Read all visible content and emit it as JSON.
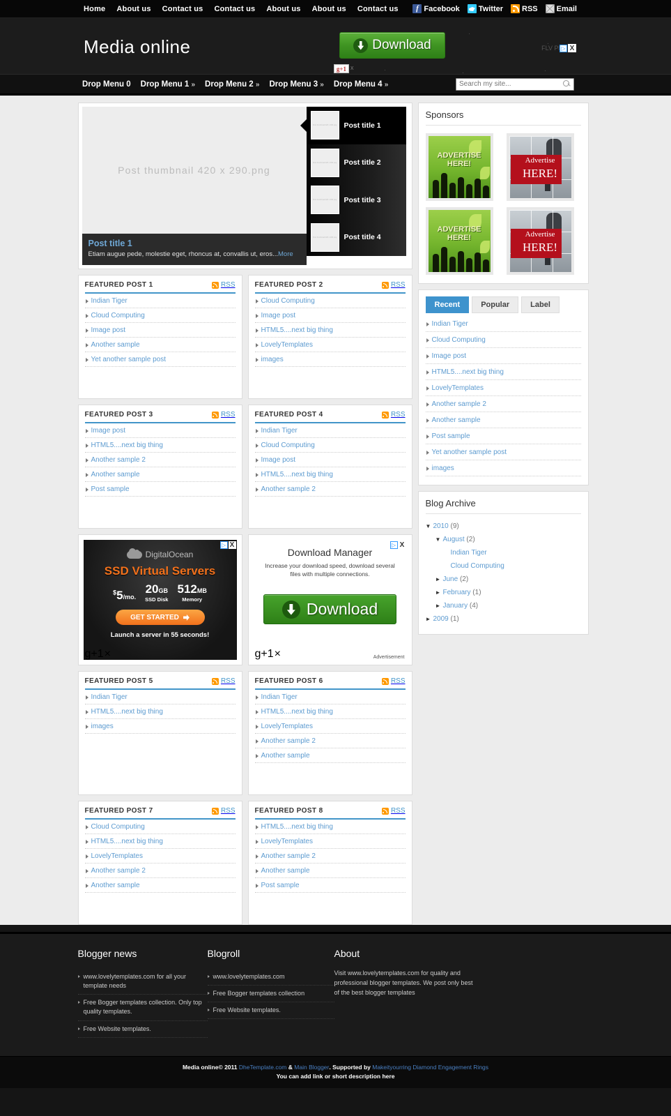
{
  "topbar": {
    "nav": [
      "Home",
      "About us",
      "Contact us",
      "Contact us",
      "About us",
      "About us",
      "Contact us"
    ],
    "social": [
      {
        "label": "Facebook",
        "icon": "facebook-icon"
      },
      {
        "label": "Twitter",
        "icon": "twitter-icon"
      },
      {
        "label": "RSS",
        "icon": "rss-icon"
      },
      {
        "label": "Email",
        "icon": "email-icon"
      }
    ]
  },
  "header": {
    "logo": "Media online",
    "ad": {
      "label": "Download",
      "gplus": "g+1",
      "close": "x",
      "flv_label": "FLV Play",
      "adchoices": "▷",
      "adclose": "X"
    }
  },
  "nav": {
    "menu": [
      {
        "label": "Drop Menu 0",
        "caret": ""
      },
      {
        "label": "Drop Menu 1",
        "caret": "»"
      },
      {
        "label": "Drop Menu 2",
        "caret": "»"
      },
      {
        "label": "Drop Menu 3",
        "caret": "»"
      },
      {
        "label": "Drop Menu 4",
        "caret": "»"
      }
    ],
    "search_placeholder": "Search my site...",
    "search_value": ""
  },
  "slider": {
    "main_image_label": "Post thumbnail 420 x 290.png",
    "caption_title": "Post title 1",
    "caption_text": "Etiam augue pede, molestie eget, rhoncus at, convallis ut, eros...",
    "caption_more": "More",
    "thumb_label": "Post thumbnail 420 x 290.png",
    "items": [
      {
        "title": "Post title 1",
        "active": true
      },
      {
        "title": "Post title 2",
        "active": false
      },
      {
        "title": "Post title 3",
        "active": false
      },
      {
        "title": "Post title 4",
        "active": false
      }
    ]
  },
  "featured": {
    "rss_label": "RSS",
    "boxes": [
      {
        "title": "FEATURED POST 1",
        "items": [
          "Indian Tiger",
          "Cloud Computing",
          "Image post",
          "Another sample",
          "Yet another sample post"
        ]
      },
      {
        "title": "FEATURED POST 2",
        "items": [
          "Cloud Computing",
          "Image post",
          "HTML5....next big thing",
          "LovelyTemplates",
          "images"
        ]
      },
      {
        "title": "FEATURED POST 3",
        "items": [
          "Image post",
          "HTML5....next big thing",
          "Another sample 2",
          "Another sample",
          "Post sample"
        ]
      },
      {
        "title": "FEATURED POST 4",
        "items": [
          "Indian Tiger",
          "Cloud Computing",
          "Image post",
          "HTML5....next big thing",
          "Another sample 2"
        ]
      },
      {
        "title": "FEATURED POST 5",
        "items": [
          "Indian Tiger",
          "HTML5....next big thing",
          "images"
        ]
      },
      {
        "title": "FEATURED POST 6",
        "items": [
          "Indian Tiger",
          "HTML5....next big thing",
          "LovelyTemplates",
          "Another sample 2",
          "Another sample"
        ]
      },
      {
        "title": "FEATURED POST 7",
        "items": [
          "Cloud Computing",
          "HTML5....next big thing",
          "LovelyTemplates",
          "Another sample 2",
          "Another sample"
        ]
      },
      {
        "title": "FEATURED POST 8",
        "items": [
          "HTML5....next big thing",
          "LovelyTemplates",
          "Another sample 2",
          "Another sample",
          "Post sample"
        ]
      }
    ]
  },
  "mid_ads": {
    "digitalocean": {
      "brand": "DigitalOcean",
      "headline": "SSD Virtual Servers",
      "stats": [
        {
          "currency": "$",
          "value": "5",
          "unit": "/mo.",
          "label": ""
        },
        {
          "currency": "",
          "value": "20",
          "unit": "GB",
          "label": "SSD Disk"
        },
        {
          "currency": "",
          "value": "512",
          "unit": "MB",
          "label": "Memory"
        }
      ],
      "cta": "GET STARTED",
      "footer": "Launch a server in 55 seconds!",
      "gplus": "g+1",
      "adchoices": "▷",
      "close": "X"
    },
    "download_manager": {
      "headline": "Download Manager",
      "body": "Increase your download speed, download several files with multiple connections.",
      "button": "Download",
      "gplus": "g+1",
      "note": "Advertisement",
      "adchoices": "▷",
      "close": "X"
    }
  },
  "sidebar": {
    "sponsors": {
      "title": "Sponsors",
      "ads": [
        {
          "type": "green",
          "line1": "ADVERTISE",
          "line2": "HERE!"
        },
        {
          "type": "red",
          "line1": "Advertise",
          "line2": "HERE!"
        },
        {
          "type": "green",
          "line1": "ADVERTISE",
          "line2": "HERE!"
        },
        {
          "type": "red",
          "line1": "Advertise",
          "line2": "HERE!"
        }
      ]
    },
    "tabs": {
      "items": [
        {
          "label": "Recent",
          "active": true
        },
        {
          "label": "Popular",
          "active": false
        },
        {
          "label": "Label",
          "active": false
        }
      ],
      "recent_list": [
        "Indian Tiger",
        "Cloud Computing",
        "Image post",
        "HTML5....next big thing",
        "LovelyTemplates",
        "Another sample 2",
        "Another sample",
        "Post sample",
        "Yet another sample post",
        "images"
      ]
    },
    "archive": {
      "title": "Blog Archive",
      "entries": [
        {
          "level": 1,
          "toggle": "▼",
          "label": "2010",
          "count": "(9)"
        },
        {
          "level": 2,
          "toggle": "▼",
          "label": "August",
          "count": "(2)"
        },
        {
          "level": 3,
          "toggle": "",
          "label": "Indian Tiger",
          "count": ""
        },
        {
          "level": 3,
          "toggle": "",
          "label": "Cloud Computing",
          "count": ""
        },
        {
          "level": 2,
          "toggle": "►",
          "label": "June",
          "count": "(2)"
        },
        {
          "level": 2,
          "toggle": "►",
          "label": "February",
          "count": "(1)"
        },
        {
          "level": 2,
          "toggle": "►",
          "label": "January",
          "count": "(4)"
        },
        {
          "level": 1,
          "toggle": "►",
          "label": "2009",
          "count": "(1)"
        }
      ]
    }
  },
  "footer": {
    "col1": {
      "title": "Blogger news",
      "items": [
        "www.lovelytemplates.com for all your template needs",
        "Free Bogger templates collection. Only top quality templates.",
        "Free Website templates."
      ]
    },
    "col2": {
      "title": "Blogroll",
      "items": [
        "www.lovelytemplates.com",
        "Free Bogger templates collection",
        "Free Website templates."
      ]
    },
    "col3": {
      "title": "About",
      "text": "Visit www.lovelytemplates.com for quality and professional blogger templates. We post only best of the best blogger templates"
    },
    "copyright": {
      "site": "Media online",
      "sym": "© 2011 ",
      "link1": "DheTemplate.com",
      "amp": " & ",
      "link2": "Main Blogger",
      "supported": ". Supported by ",
      "link3": "Makeityourring Diamond Engagement Rings",
      "line2": "You can add link or short description here"
    }
  },
  "colors": {
    "accent": "#4295c9",
    "link": "#5d9bd0",
    "page_bg": "#ececec",
    "dark": "#1c1c1c"
  }
}
